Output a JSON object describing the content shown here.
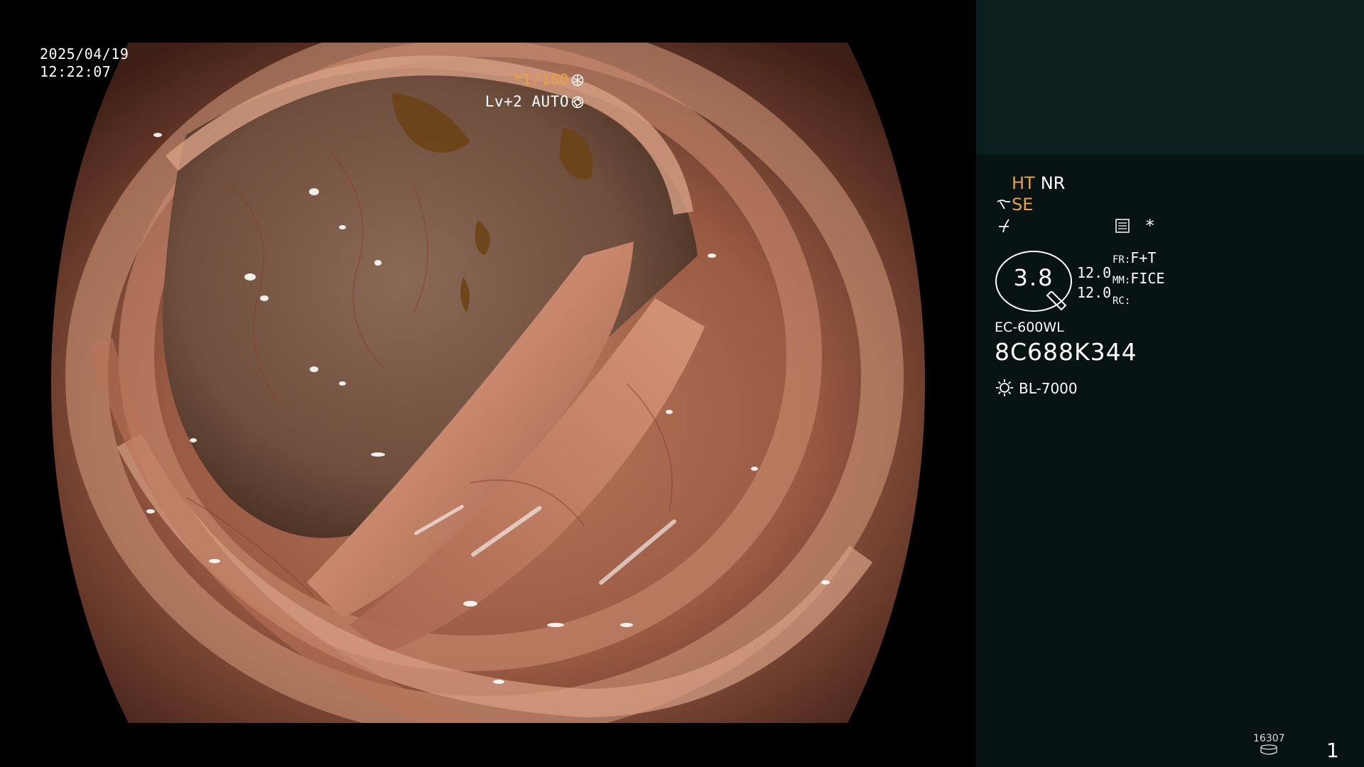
{
  "overlay": {
    "date": "2025/04/19",
    "time": "12:22:07",
    "shutter": "*1/100",
    "shutter_icon": "shutter-icon",
    "level": "Lv+2 AUTO",
    "iris_icon": "iris-icon"
  },
  "panel": {
    "mode_ht": "HT",
    "mode_nr": "NR",
    "mode_se": "SE",
    "se_icon": "structure-enhance-icon",
    "freeze_icon": "freeze-icon",
    "memo_icon": "memo-icon",
    "asterisk": "*",
    "zoom": "3.8",
    "zoom_icon": "zoom-magnifier-icon",
    "val1": "12.0",
    "val2": "12.0",
    "fr_label": "FR:",
    "fr_value": "F+T",
    "mm_label": "MM:",
    "mm_value": "FICE",
    "rc_label": "RC:",
    "rc_value": "",
    "scope_model": "EC-600WL",
    "scope_serial": "8C688K344",
    "light_icon": "light-source-icon",
    "light_source": "BL-7000",
    "counter": "16307",
    "counter_icon": "storage-disk-icon",
    "page_number": "1"
  },
  "colors": {
    "accent_amber": "#e9a23b",
    "panel_bg": "#071313",
    "panel_top_bg": "#0b1f1f"
  }
}
